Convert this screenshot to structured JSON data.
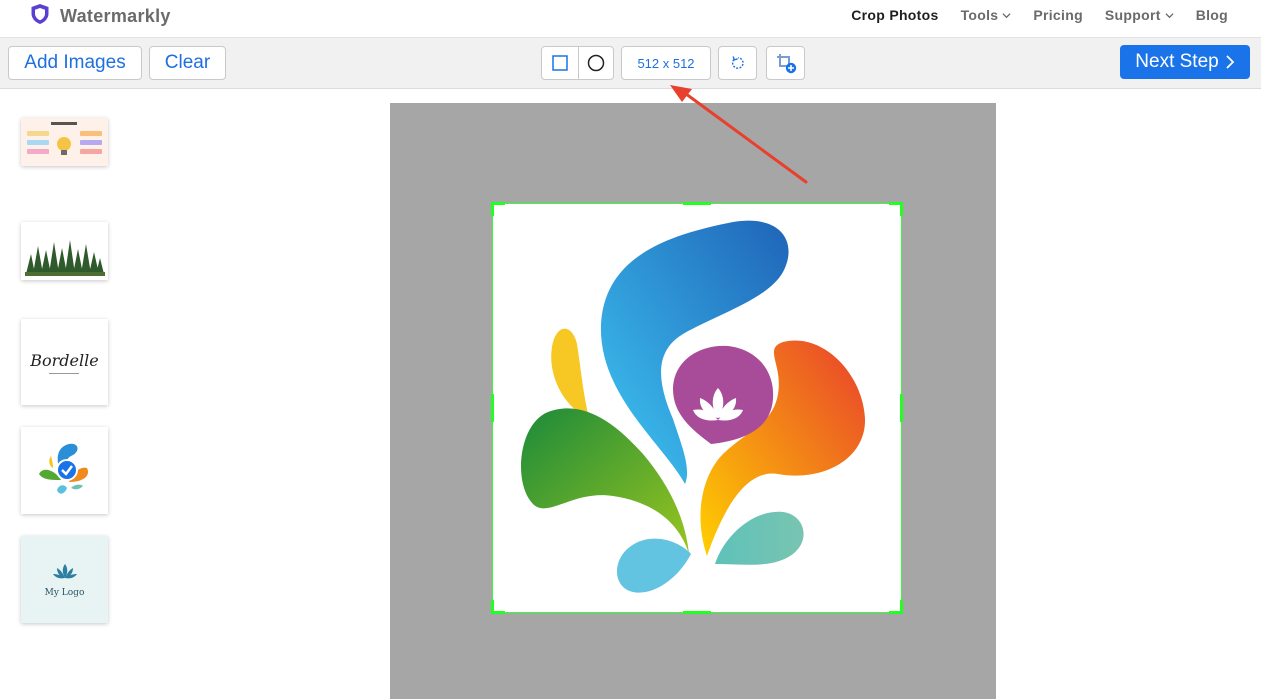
{
  "app": {
    "brand": "Watermarkly"
  },
  "nav": {
    "items": [
      {
        "label": "Crop Photos",
        "active": true,
        "dropdown": false
      },
      {
        "label": "Tools",
        "active": false,
        "dropdown": true
      },
      {
        "label": "Pricing",
        "active": false,
        "dropdown": false
      },
      {
        "label": "Support",
        "active": false,
        "dropdown": true
      },
      {
        "label": "Blog",
        "active": false,
        "dropdown": false
      }
    ]
  },
  "toolbar": {
    "add_images_label": "Add Images",
    "clear_label": "Clear",
    "shape_square_icon": "square-shape-icon",
    "shape_circle_icon": "circle-shape-icon",
    "size_label": "512 x 512",
    "rotate_icon": "rotate-icon",
    "add_crop_icon": "add-crop-icon",
    "next_step_label": "Next Step"
  },
  "sidebar": {
    "thumbnails": [
      {
        "name": "infographic-thumbnail",
        "selected": false
      },
      {
        "name": "forest-thumbnail",
        "selected": false
      },
      {
        "name": "bordelle-logo-thumbnail",
        "text": "Bordelle",
        "selected": false
      },
      {
        "name": "splash-logo-thumbnail",
        "selected": true
      },
      {
        "name": "my-logo-thumbnail",
        "text": "My Logo",
        "selected": false
      }
    ]
  },
  "colors": {
    "accent": "#1a73e8",
    "crop_frame": "#22ff22",
    "canvas_bg": "#a6a6a6",
    "annotation_arrow": "#e8402c"
  }
}
